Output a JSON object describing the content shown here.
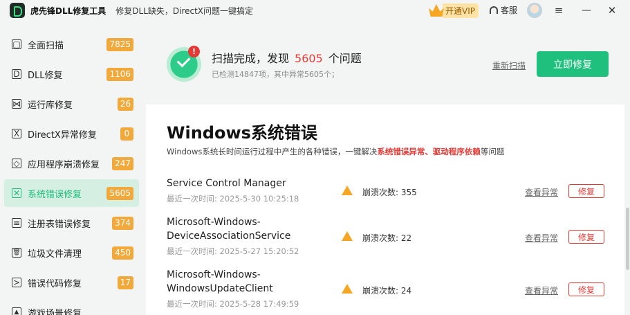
{
  "titlebar": {
    "app_title": "虎先锋DLL修复工具",
    "subtitle": "修复DLL缺失，DirectX问题一键搞定",
    "vip_label": "开通VIP",
    "support_label": "客服",
    "menu_glyph": "≡",
    "minimize_glyph": "—",
    "close_glyph": "✕"
  },
  "sidebar": {
    "items": [
      {
        "label": "全面扫描",
        "count": "7825",
        "icon": "monitor-icon",
        "glyph": "▢"
      },
      {
        "label": "DLL修复",
        "count": "1106",
        "icon": "dll-icon",
        "glyph": "D"
      },
      {
        "label": "运行库修复",
        "count": "26",
        "icon": "bowtie-icon",
        "glyph": "⋈"
      },
      {
        "label": "DirectX异常修复",
        "count": "0",
        "icon": "directx-icon",
        "glyph": "X"
      },
      {
        "label": "应用程序崩溃修复",
        "count": "247",
        "icon": "cube-icon",
        "glyph": "◇"
      },
      {
        "label": "系统错误修复",
        "count": "5605",
        "icon": "system-error-icon",
        "glyph": "✕"
      },
      {
        "label": "注册表错误修复",
        "count": "374",
        "icon": "registry-icon",
        "glyph": "≡"
      },
      {
        "label": "垃圾文件清理",
        "count": "450",
        "icon": "trash-icon",
        "glyph": "🗑"
      },
      {
        "label": "错误代码修复",
        "count": "17",
        "icon": "terminal-icon",
        "glyph": ">"
      },
      {
        "label": "游戏场景修复",
        "count": "",
        "icon": "game-icon",
        "glyph": "▲"
      }
    ],
    "active_index": 5
  },
  "header": {
    "title_prefix": "扫描完成，发现",
    "issue_count": "5605",
    "title_suffix": "个问题",
    "detail": "已检测14847项，其中异常5605个；",
    "alert_glyph": "!",
    "rescan_label": "重新扫描",
    "fix_now_label": "立即修复"
  },
  "main": {
    "section_title": "Windows系统错误",
    "desc_prefix": "Windows系统长时间运行过程中产生的各种错误，一键解决",
    "desc_highlight": "系统错误异常、驱动程序依赖",
    "desc_suffix": "等问题",
    "errors": [
      {
        "name": "Service Control Manager",
        "time": "最近一次时间: 2025-5-30 10:25:18",
        "crash_label": "崩溃次数: 355",
        "view_label": "查看异常",
        "fix_label": "修复"
      },
      {
        "name": "Microsoft-Windows-DeviceAssociationService",
        "time": "最近一次时间: 2025-5-27 15:20:52",
        "crash_label": "崩溃次数: 22",
        "view_label": "查看异常",
        "fix_label": "修复"
      },
      {
        "name": "Microsoft-Windows-WindowsUpdateClient",
        "time": "最近一次时间: 2025-5-28 17:49:59",
        "crash_label": "崩溃次数: 24",
        "view_label": "查看异常",
        "fix_label": "修复"
      }
    ]
  },
  "colors": {
    "accent_green": "#1fc07d",
    "alert_red": "#e53935",
    "badge_orange": "#f2a93b"
  }
}
